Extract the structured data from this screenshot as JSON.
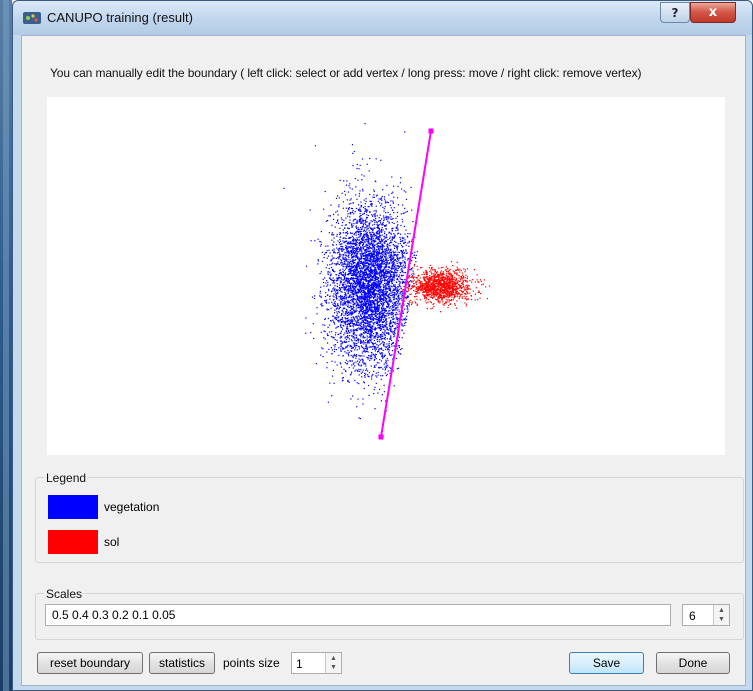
{
  "window": {
    "title": "CANUPO training (result)",
    "help_glyph": "?",
    "close_glyph": "x"
  },
  "instructions": "You can manually edit the boundary ( left click: select or add vertex / long press: move / right click: remove vertex)",
  "plot": {
    "classes": [
      {
        "name": "vegetation",
        "color": "#0000ff"
      },
      {
        "name": "sol",
        "color": "#ff0000"
      }
    ],
    "boundary_color": "#ff00ff"
  },
  "legend": {
    "title": "Legend",
    "items": [
      {
        "label": "vegetation",
        "color": "#0000ff"
      },
      {
        "label": "sol",
        "color": "#ff0000"
      }
    ]
  },
  "scales": {
    "title": "Scales",
    "value": "0.5 0.4 0.3 0.2 0.1 0.05",
    "count": "6"
  },
  "footer": {
    "reset_label": "reset boundary",
    "statistics_label": "statistics",
    "points_size_label": "points size",
    "points_size_value": "1",
    "save_label": "Save",
    "done_label": "Done"
  }
}
